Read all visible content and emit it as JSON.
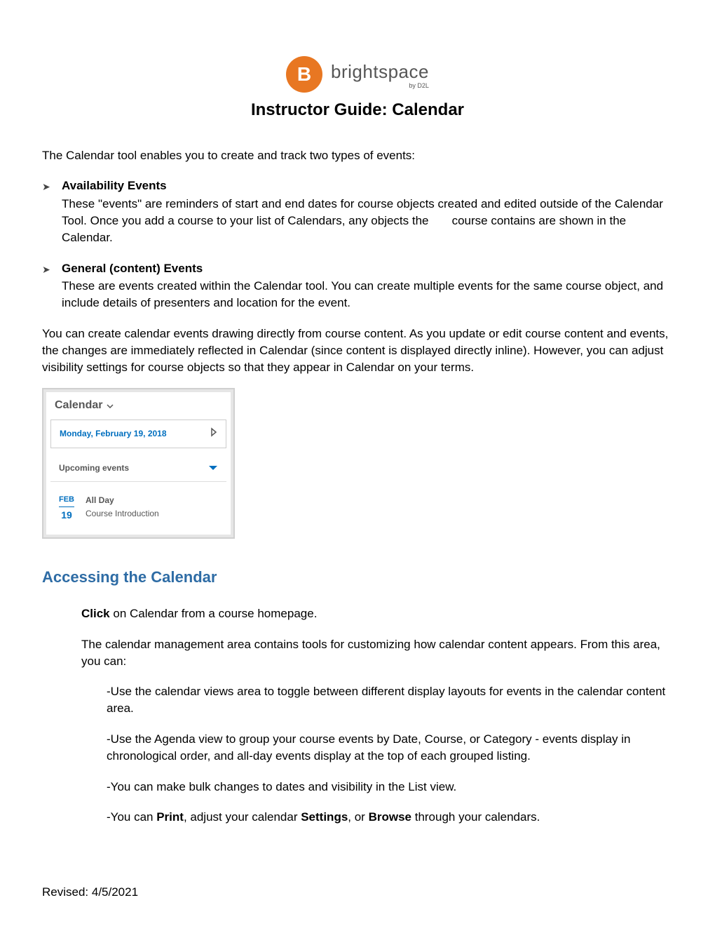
{
  "logo": {
    "glyph": "B",
    "brand": "brightspace",
    "byline": "by D2L"
  },
  "title": "Instructor Guide: Calendar",
  "intro": "The Calendar tool enables you to create and track two types of events:",
  "bullets": [
    {
      "title": "Availability Events",
      "body_a": "These \"events\" are reminders of start and end dates for course objects created and edited outside of the Calendar Tool. Once you add a course to your list of Calendars, any objects the",
      "body_b": "course contains are shown in the Calendar."
    },
    {
      "title": "General (content) Events",
      "body_a": "These are events created within the Calendar tool. You can create multiple events for the same course object, and include details of presenters and location for the event.",
      "body_b": ""
    }
  ],
  "para_after": "You can create calendar events drawing directly from course content. As you update or edit course content and events, the changes are immediately reflected in Calendar (since content is displayed directly inline). However, you can adjust visibility settings for course objects so that they appear in Calendar on your terms.",
  "widget": {
    "header": "Calendar",
    "date": "Monday, February 19, 2018",
    "upcoming": "Upcoming events",
    "event": {
      "month": "FEB",
      "day": "19",
      "time": "All Day",
      "title": "Course Introduction"
    }
  },
  "section_heading": "Accessing the Calendar",
  "access": {
    "click_bold": "Click",
    "click_rest": " on Calendar from a course homepage.",
    "mgmt": "The calendar management area contains tools for customizing how calendar content appears. From this area, you can:",
    "items": [
      "-Use the calendar views area to toggle between different display layouts for events in the calendar content area.",
      "-Use the Agenda view to group your course events by Date, Course, or Category - events display in chronological order, and all-day events display at the top of each grouped listing.",
      "-You can make bulk changes to dates and visibility in the List view."
    ],
    "last_line": {
      "p1": "-You can ",
      "b1": "Print",
      "p2": ", adjust your calendar ",
      "b2": "Settings",
      "p3": ", or ",
      "b3": "Browse",
      "p4": " through your calendars."
    }
  },
  "footer": "Revised: 4/5/2021"
}
